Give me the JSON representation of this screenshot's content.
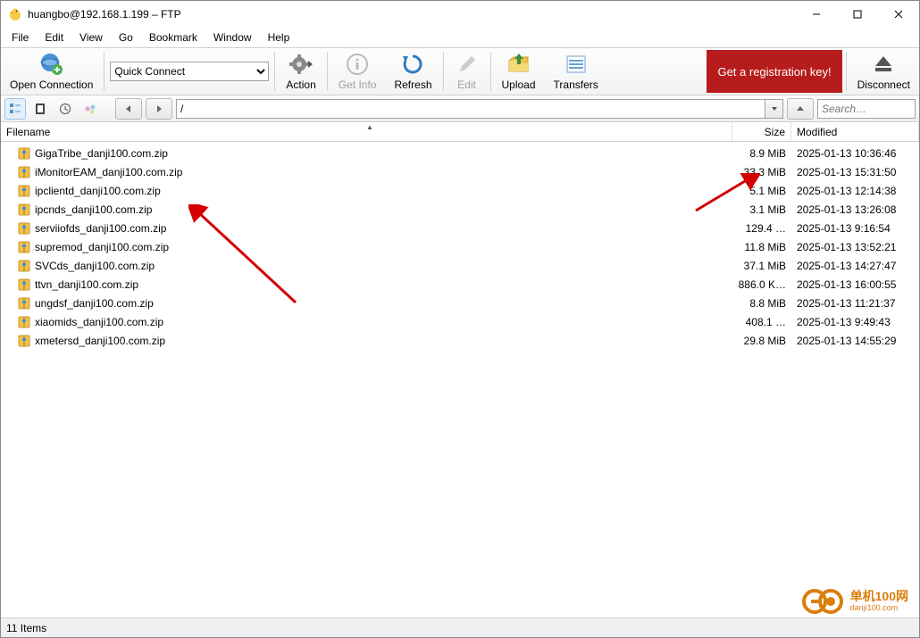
{
  "window": {
    "title": "huangbo@192.168.1.199 – FTP"
  },
  "menu": [
    "File",
    "Edit",
    "View",
    "Go",
    "Bookmark",
    "Window",
    "Help"
  ],
  "toolbar": {
    "open_connection": "Open Connection",
    "quick_connect": "Quick Connect",
    "action": "Action",
    "get_info": "Get Info",
    "refresh": "Refresh",
    "edit": "Edit",
    "upload": "Upload",
    "transfers": "Transfers",
    "reg_key": "Get a registration key!",
    "disconnect": "Disconnect"
  },
  "nav": {
    "path": "/",
    "search_placeholder": "Search…"
  },
  "columns": {
    "filename": "Filename",
    "size": "Size",
    "modified": "Modified"
  },
  "files": [
    {
      "name": "GigaTribe_danji100.com.zip",
      "size": "8.9 MiB",
      "modified": "2025-01-13 10:36:46"
    },
    {
      "name": "iMonitorEAM_danji100.com.zip",
      "size": "33.3 MiB",
      "modified": "2025-01-13 15:31:50"
    },
    {
      "name": "ipclientd_danji100.com.zip",
      "size": "5.1 MiB",
      "modified": "2025-01-13 12:14:38"
    },
    {
      "name": "ipcnds_danji100.com.zip",
      "size": "3.1 MiB",
      "modified": "2025-01-13 13:26:08"
    },
    {
      "name": "serviiofds_danji100.com.zip",
      "size": "129.4 …",
      "modified": "2025-01-13 9:16:54"
    },
    {
      "name": "supremod_danji100.com.zip",
      "size": "11.8 MiB",
      "modified": "2025-01-13 13:52:21"
    },
    {
      "name": "SVCds_danji100.com.zip",
      "size": "37.1 MiB",
      "modified": "2025-01-13 14:27:47"
    },
    {
      "name": "ttvn_danji100.com.zip",
      "size": "886.0 K…",
      "modified": "2025-01-13 16:00:55"
    },
    {
      "name": "ungdsf_danji100.com.zip",
      "size": "8.8 MiB",
      "modified": "2025-01-13 11:21:37"
    },
    {
      "name": "xiaomids_danji100.com.zip",
      "size": "408.1 …",
      "modified": "2025-01-13 9:49:43"
    },
    {
      "name": "xmetersd_danji100.com.zip",
      "size": "29.8 MiB",
      "modified": "2025-01-13 14:55:29"
    }
  ],
  "status": "11 Items",
  "watermark": {
    "line1": "单机100网",
    "line2": "danji100.com"
  }
}
